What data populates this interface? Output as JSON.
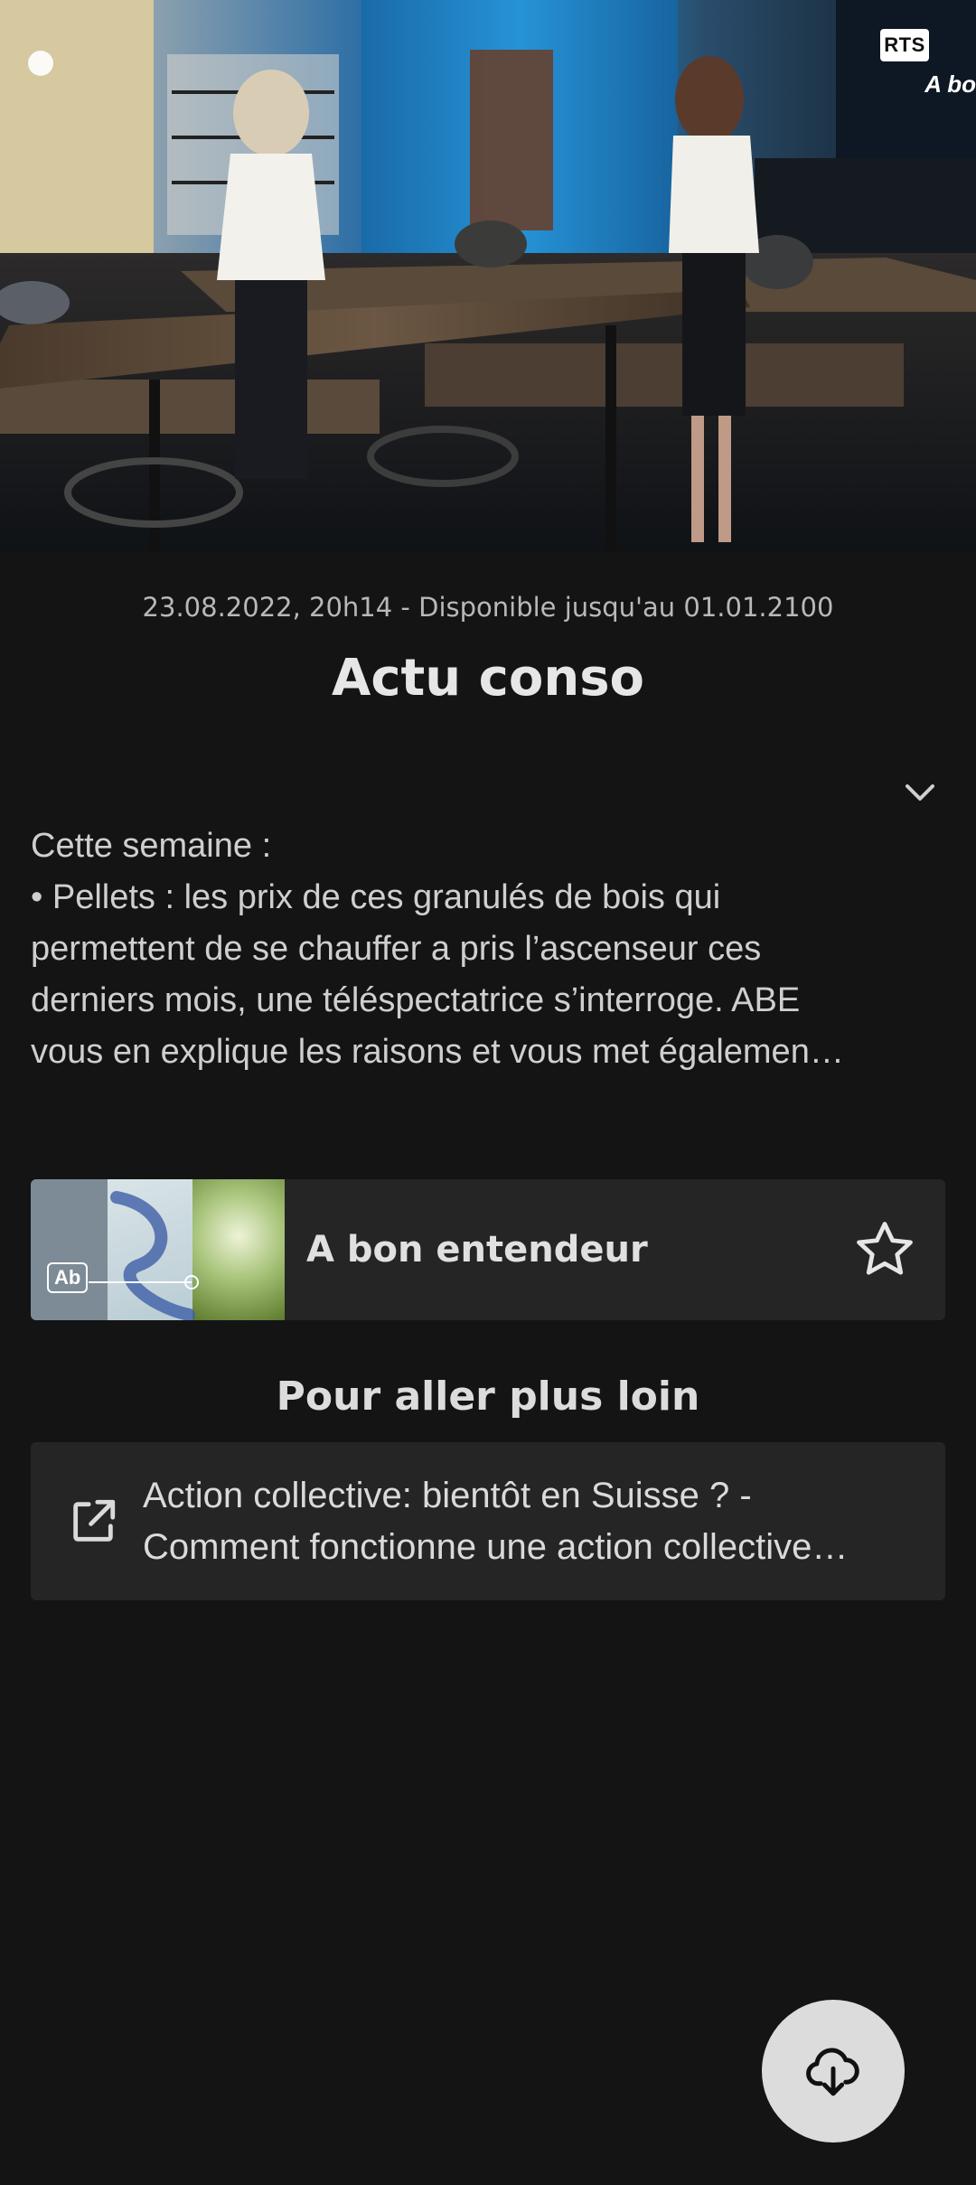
{
  "video": {
    "channel_badge": "RTS",
    "corner_logo": "A bo"
  },
  "episode": {
    "meta": "23.08.2022, 20h14 - Disponible jusqu'au 01.01.2100",
    "title": "Actu conso",
    "expand_icon": "chevron-down-icon",
    "description_lines": [
      "Cette semaine :",
      "• Pellets : les prix de ces granulés de bois qui",
      "permettent de se chauffer a pris l’ascenseur ces",
      "derniers mois, une téléspectatrice s’interroge. ABE",
      "vous en explique les raisons et vous met égalemen…"
    ]
  },
  "show": {
    "thumb_logo": "Ab",
    "name": "A bon entendeur",
    "favorite_icon": "star-outline-icon"
  },
  "more": {
    "section_title": "Pour aller plus loin",
    "link_icon": "external-link-icon",
    "link_lines": [
      "Action collective: bientôt en Suisse ? -",
      "Comment fonctionne une action collective…"
    ]
  },
  "fab": {
    "icon": "cloud-download-icon"
  },
  "colors": {
    "background": "#141414",
    "card": "#252525",
    "fab": "#dcdcdc"
  }
}
